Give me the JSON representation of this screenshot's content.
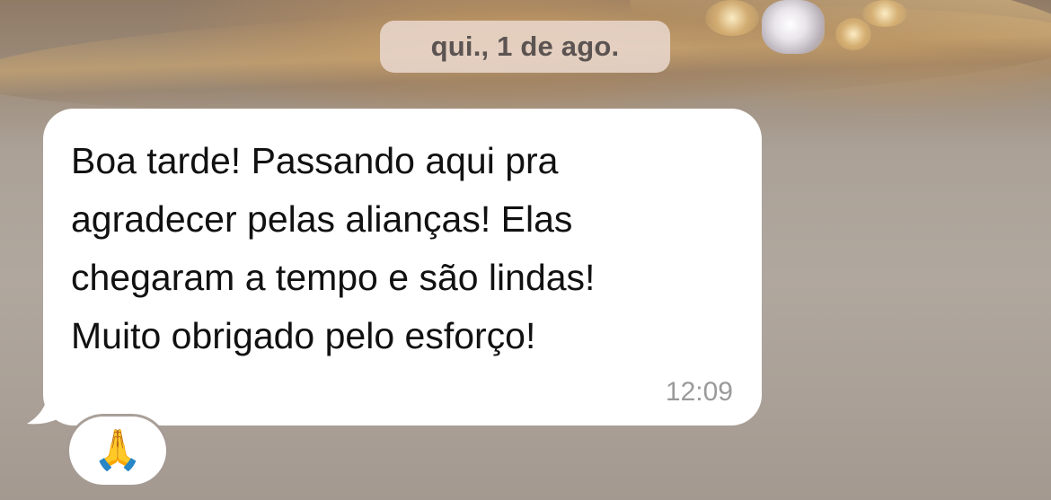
{
  "date_separator": "qui., 1 de ago.",
  "message": {
    "lines": [
      "Boa tarde! Passando aqui pra",
      "agradecer pelas alianças! Elas",
      "chegaram a tempo e são lindas!",
      "Muito obrigado pelo esforço!"
    ],
    "time": "12:09"
  },
  "reaction": {
    "emoji": "🙏",
    "icon": "praying-hands-icon"
  },
  "colors": {
    "bubble": "#ffffff",
    "date_chip": "#e8d6cc",
    "timestamp": "#9a9a9a",
    "text": "#111111"
  }
}
